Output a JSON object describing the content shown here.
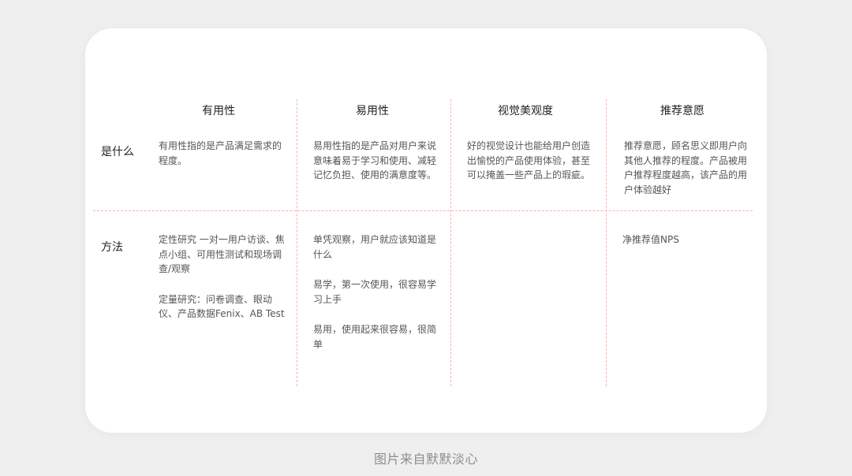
{
  "columns": [
    "有用性",
    "易用性",
    "视觉美观度",
    "推荐意愿"
  ],
  "rows": [
    "是什么",
    "方法"
  ],
  "what": {
    "usefulness": "有用性指的是产品满足需求的程度。",
    "usability": "易用性指的是产品对用户来说意味着易于学习和使用、减轻记忆负担、使用的满意度等。",
    "aesthetics": "好的视觉设计也能给用户创造出愉悦的产品使用体验，甚至可以掩盖一些产品上的瑕疵。",
    "recommend": "推荐意愿，顾名思义即用户向其他人推荐的程度。产品被用户推荐程度越高，该产品的用户体验越好"
  },
  "methods": {
    "usefulness": [
      "定性研究 一对一用户访谈、焦点小组、可用性测试和现场调查/观察",
      "定量研究：问卷调查、眼动仪、产品数据Fenix、AB Test"
    ],
    "usability": [
      "单凭观察，用户就应该知道是什么",
      "易学，第一次使用，很容易学习上手",
      "易用，使用起来很容易，很简单"
    ],
    "aesthetics": [],
    "recommend": [
      "净推荐值NPS"
    ]
  },
  "caption": "图片来自默默淡心"
}
